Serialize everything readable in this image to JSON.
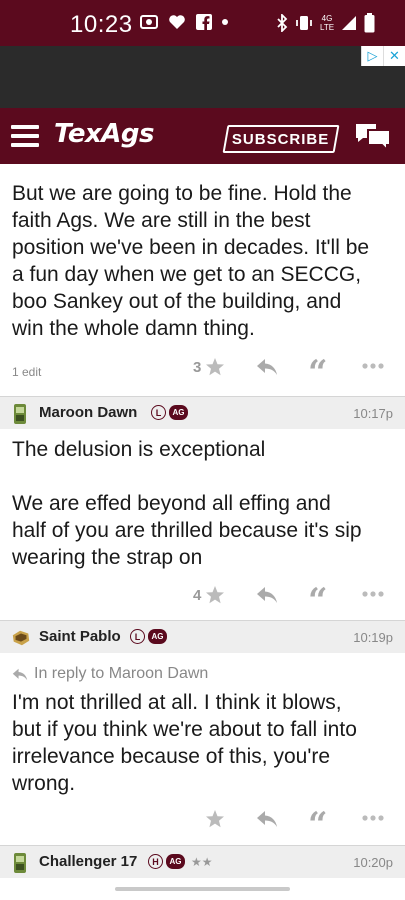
{
  "status_bar": {
    "time": "10:23",
    "network_label": "4G LTE",
    "icons": [
      "camera-icon",
      "heart-icon",
      "facebook-icon",
      "dot-icon",
      "bluetooth-icon",
      "vibrate-icon",
      "signal-icon",
      "battery-icon"
    ]
  },
  "header": {
    "logo": "TexAgs",
    "subscribe_label": "SUBSCRIBE",
    "brand_color": "#5b0a1e"
  },
  "posts": [
    {
      "body": [
        "But we are going to be fine. Hold the",
        "faith Ags. We are still in the best",
        "position we've been in decades. It'll be",
        "a fun day when we get to an SECCG,",
        "boo Sankey out of the building, and",
        "win the whole damn thing."
      ],
      "edit_note": "1 edit",
      "star_count": "3"
    },
    {
      "username": "Maroon Dawn",
      "badge_letter": "L",
      "badge_ag": "AG",
      "time": "10:17p",
      "body_line1": "The delusion is exceptional",
      "body_rest": [
        "We are effed beyond all effing and",
        "half of you are thrilled because it's sip",
        "wearing the strap on"
      ],
      "star_count": "4"
    },
    {
      "username": "Saint Pablo",
      "badge_letter": "L",
      "badge_ag": "AG",
      "time": "10:19p",
      "reply_to": "In reply to Maroon Dawn",
      "body": [
        "I'm not thrilled at all. I think it blows,",
        "but if you think we're about to fall into",
        "irrelevance because of this, you're",
        "wrong."
      ]
    },
    {
      "username": "Challenger 17",
      "badge_letter": "H",
      "badge_ag": "AG",
      "stars": "★★",
      "time": "10:20p"
    }
  ]
}
